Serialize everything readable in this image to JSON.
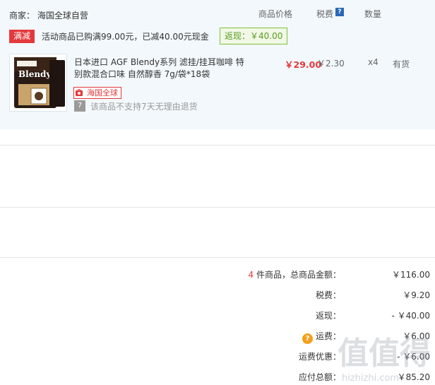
{
  "seller": {
    "label": "商家： 海国全球自营"
  },
  "columns": {
    "price": "商品价格",
    "tax": "税费",
    "tax_help": "?",
    "qty": "数量"
  },
  "promo": {
    "badge": "满减",
    "text": "活动商品已购满99.00元，已减40.00元现金",
    "rebate": "返现：￥40.00"
  },
  "item": {
    "brand_on_pack": "Blendy",
    "title": "日本进口 AGF Blendy系列 滤挂/挂耳咖啡 特别款混合口味 自然醇香 7g/袋*18袋",
    "tag": "海国全球",
    "return_icon_text": "7",
    "return_note": "该商品不支持7天无理由退货",
    "price": "￥29.00",
    "tax": "￥2.30",
    "qty": "x4",
    "stock": "有货"
  },
  "summary": {
    "count": "4",
    "count_suffix": " 件商品，总商品金额：",
    "goods_total": "￥116.00",
    "tax_label": "税费：",
    "tax_value": "￥9.20",
    "rebate_label": "返现：",
    "rebate_value": "- ￥40.00",
    "shipping_help": "?",
    "shipping_label": "运费：",
    "shipping_value": "￥6.00",
    "shipping_discount_label": "运费优惠：",
    "shipping_discount_value": "- ￥6.00",
    "payable_label": "应付总额：",
    "payable_value": "￥85.20"
  },
  "watermark": {
    "text": "值值得",
    "sub": "hizhizhi.com"
  },
  "colors": {
    "accent_red": "#e4393c",
    "panel_bg": "#f3f8fc",
    "rebate_green": "#5a9b1f",
    "help_orange": "#f59f1a"
  }
}
